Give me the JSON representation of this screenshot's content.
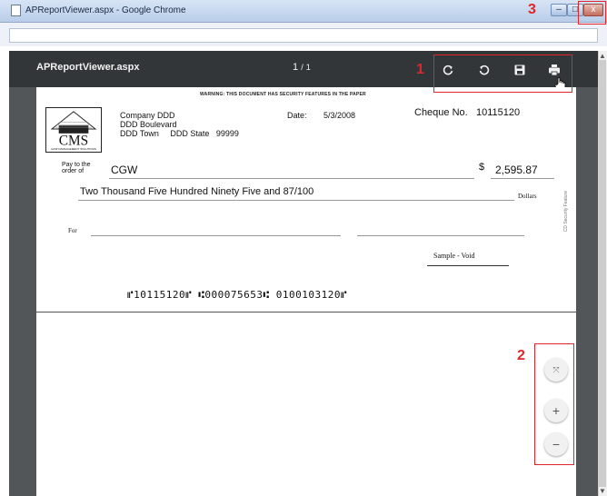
{
  "window": {
    "title": "APReportViewer.aspx - Google Chrome",
    "minimize_glyph": "–",
    "maximize_glyph": "□",
    "close_glyph": "x"
  },
  "viewer": {
    "doc_title": "APReportViewer.aspx",
    "page_current": "1",
    "page_sep": "/",
    "page_total": "1",
    "toolbar_icons": [
      "rotate-counterclockwise-icon",
      "rotate-clockwise-icon",
      "save-icon",
      "print-icon"
    ]
  },
  "cheque": {
    "warning": "WARNING: THIS DOCUMENT HAS SECURITY FEATURES IN THE PAPER",
    "logo_text": "CMS",
    "logo_subtext": "CASH MANAGEMENT SOLUTIONS",
    "company_name": "Company DDD",
    "company_address1": "DDD Boulevard",
    "company_town": "DDD Town",
    "company_state": "DDD State",
    "company_zip": "99999",
    "date_label": "Date:",
    "date_value": "5/3/2008",
    "cheque_label": "Cheque No.",
    "cheque_number": "10115120",
    "pay_to_label1": "Pay to the",
    "pay_to_label2": "order of",
    "payee": "CGW",
    "currency_symbol": "$",
    "amount": "2,595.87",
    "amount_words": "Two Thousand Five Hundred Ninety Five and 87/100",
    "dollars_label": "Dollars",
    "side_mark": "CD Security Feature",
    "for_label": "For",
    "sample_void": "Sample - Void",
    "micr_line": "⑈10115120⑈  ⑆000075653⑆  0100103120⑈"
  },
  "zoom": {
    "fit_glyph": "⤧",
    "plus_glyph": "+",
    "minus_glyph": "−"
  },
  "annotations": {
    "label_1": "1",
    "label_2": "2",
    "label_3": "3",
    "color": "#e0262a"
  }
}
